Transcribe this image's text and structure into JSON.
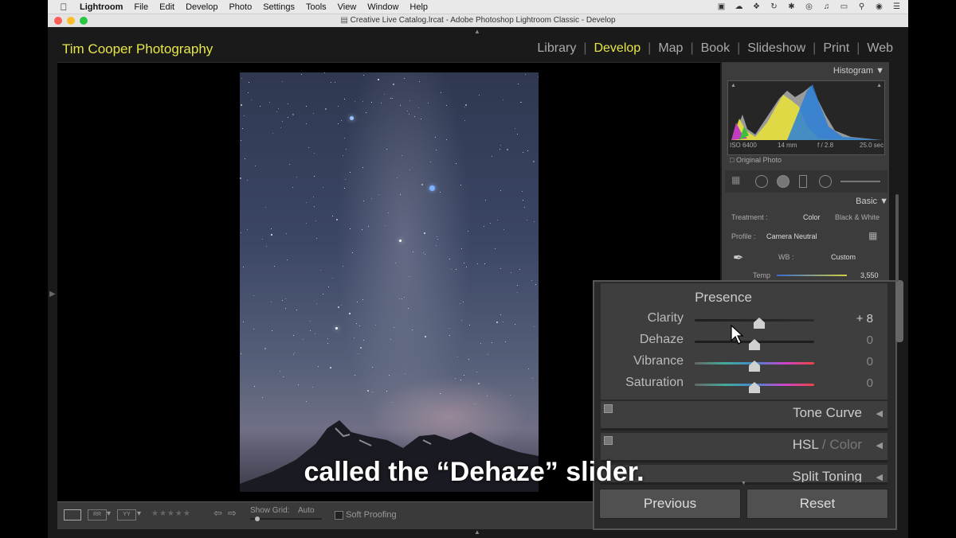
{
  "menubar": {
    "app": "Lightroom",
    "items": [
      "File",
      "Edit",
      "Develop",
      "Photo",
      "Settings",
      "Tools",
      "View",
      "Window",
      "Help"
    ]
  },
  "window": {
    "title": "Creative Live Catalog.lrcat - Adobe Photoshop Lightroom Classic - Develop"
  },
  "identity_plate": "Tim Cooper Photography",
  "modules": [
    "Library",
    "Develop",
    "Map",
    "Book",
    "Slideshow",
    "Print",
    "Web"
  ],
  "active_module": "Develop",
  "histogram": {
    "header": "Histogram",
    "iso": "ISO 6400",
    "focal": "14 mm",
    "aperture": "f / 2.8",
    "shutter": "25.0 sec",
    "original_photo": "Original Photo"
  },
  "basic": {
    "header": "Basic",
    "treatment_label": "Treatment :",
    "treatment_color": "Color",
    "treatment_bw": "Black & White",
    "profile_label": "Profile :",
    "profile_value": "Camera Neutral",
    "wb_label": "WB :",
    "wb_value": "Custom",
    "temp_label": "Temp",
    "temp_value": "3,550"
  },
  "presence": {
    "title": "Presence",
    "sliders": [
      {
        "label": "Clarity",
        "value": "+ 8",
        "level": 0.54
      },
      {
        "label": "Dehaze",
        "value": "0",
        "level": 0.5
      },
      {
        "label": "Vibrance",
        "value": "0",
        "level": 0.5
      },
      {
        "label": "Saturation",
        "value": "0",
        "level": 0.5
      }
    ]
  },
  "panels": {
    "tone_curve": "Tone Curve",
    "hsl": "HSL",
    "slash": " / ",
    "color": "Color",
    "split_toning": "Split Toning"
  },
  "buttons": {
    "previous": "Previous",
    "reset": "Reset"
  },
  "toolbar": {
    "show_grid": "Show Grid:",
    "grid_value": "Auto",
    "soft_proofing": "Soft Proofing"
  },
  "caption": "called the “Dehaze” slider."
}
